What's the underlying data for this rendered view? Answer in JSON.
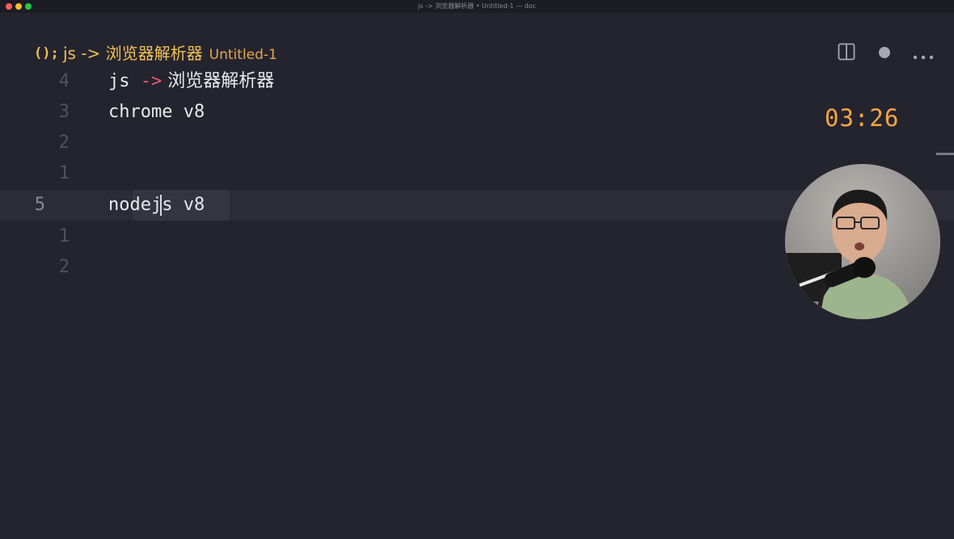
{
  "window": {
    "title": "js -> 浏览器解析器 • Untitled-1 — doc",
    "traffic_colors": [
      "#ff5f57",
      "#febc2e",
      "#28c840"
    ]
  },
  "tab": {
    "icon_text": "();",
    "filename": "js -> 浏览器解析器",
    "subtitle": "Untitled-1"
  },
  "toolbar": {
    "split_icon": "split-editor-icon",
    "dirty_icon": "unsaved-dot-icon",
    "more_icon": "more-ellipsis-icon"
  },
  "editor": {
    "lines": [
      {
        "number": "4",
        "text_a": "js ",
        "arrow": "->",
        "text_b": " 浏览器解析器"
      },
      {
        "number": "3",
        "text": "chrome v8"
      },
      {
        "number": "2",
        "text": ""
      },
      {
        "number": "1",
        "text": ""
      },
      {
        "number": "5",
        "text": "nodejs v8",
        "current": true
      },
      {
        "number": "1",
        "text": ""
      },
      {
        "number": "2",
        "text": ""
      }
    ]
  },
  "timer": "03:26",
  "colors": {
    "background": "#24242f",
    "accent": "#f2c056",
    "arrow": "#e85a72",
    "timer": "#f5a742"
  }
}
